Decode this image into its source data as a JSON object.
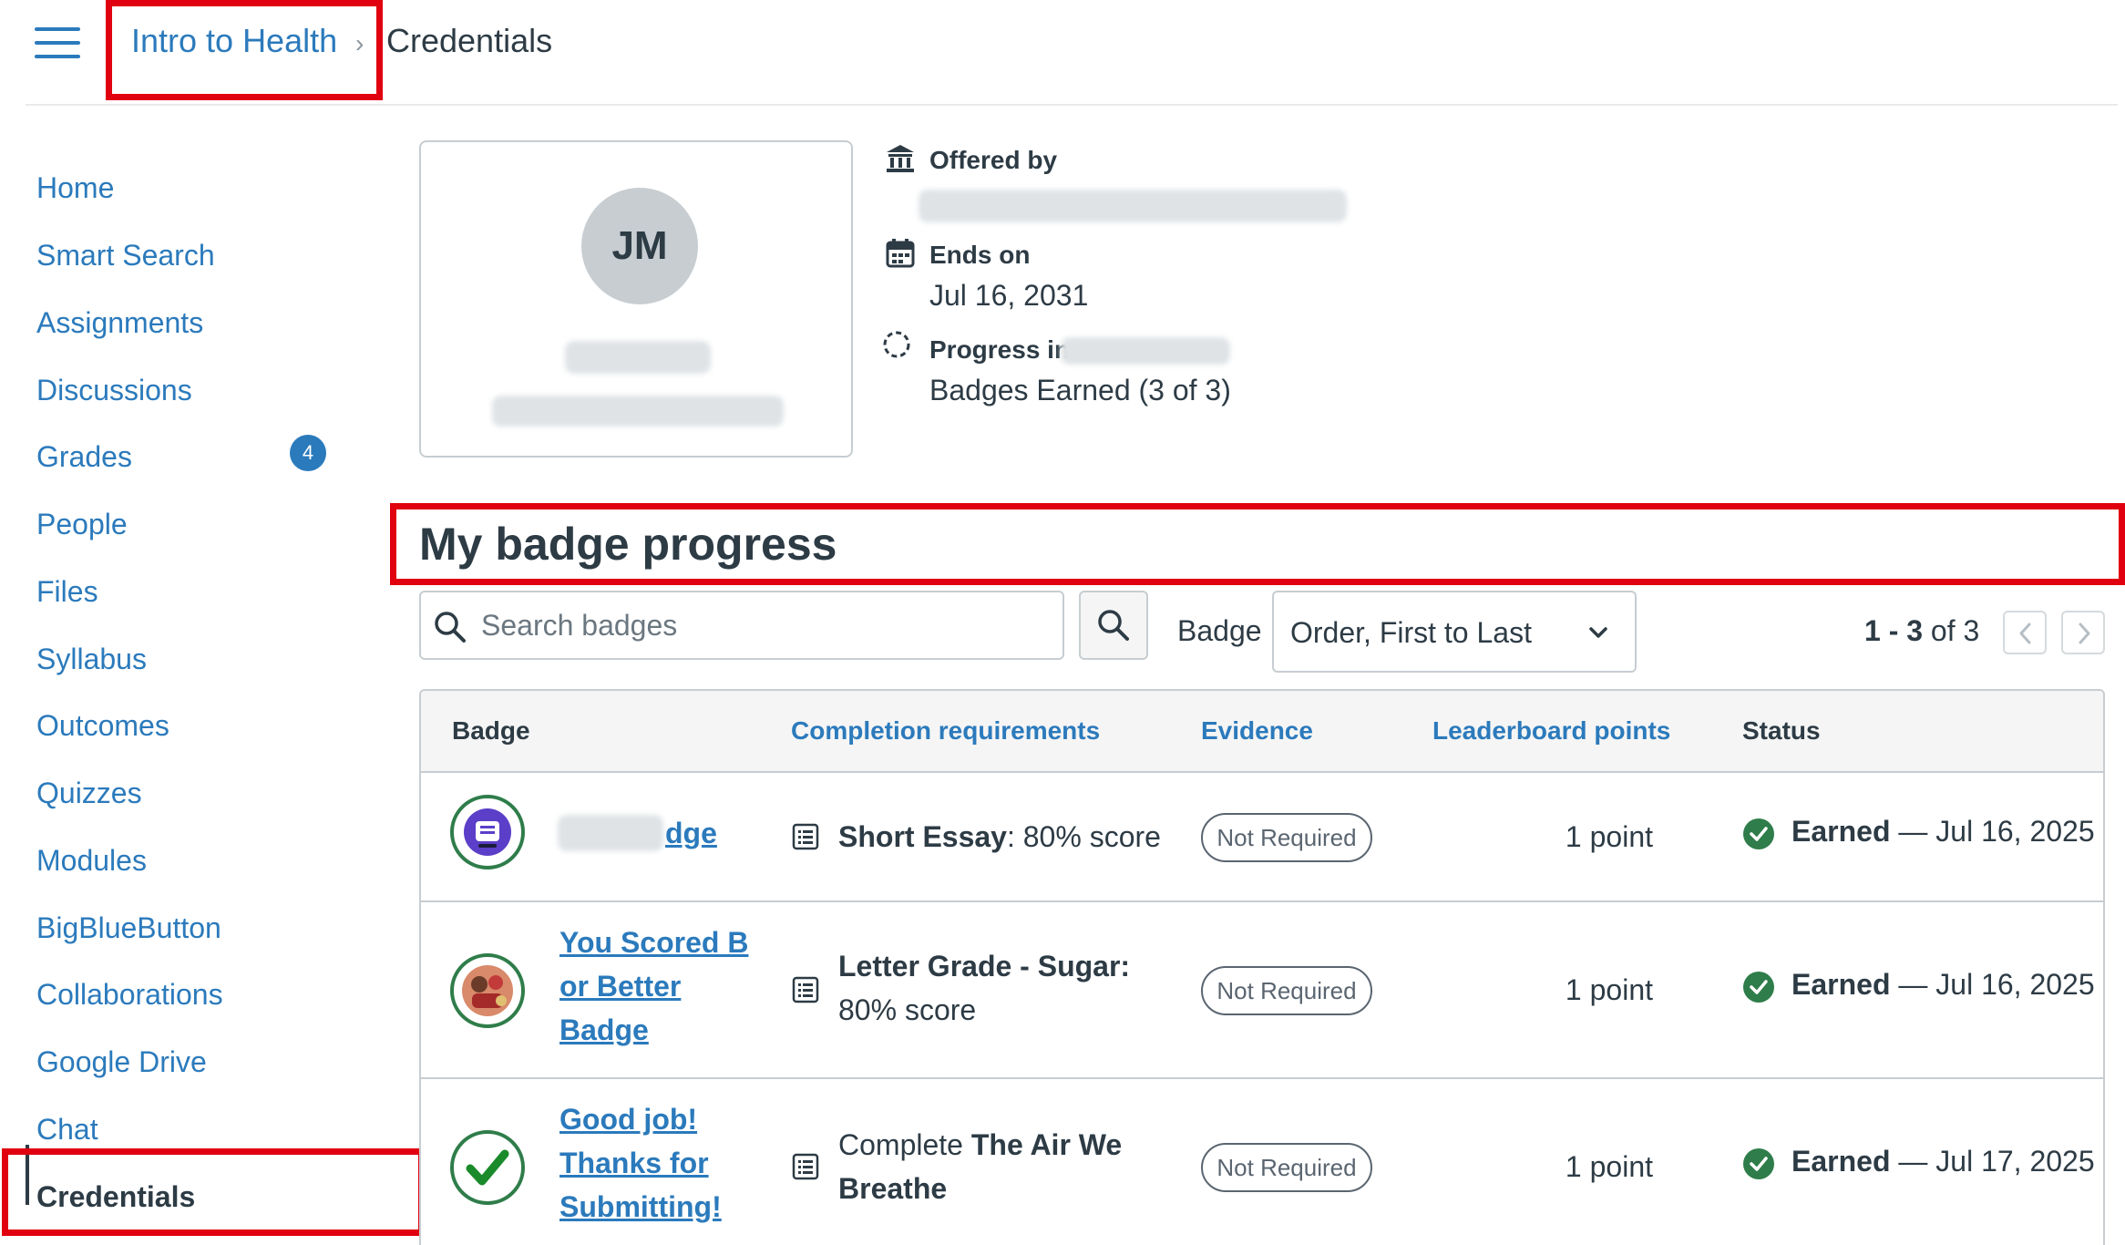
{
  "header": {
    "course": "Intro to Health",
    "separator": "›",
    "current_page": "Credentials"
  },
  "sidebar": {
    "items": [
      {
        "label": "Home"
      },
      {
        "label": "Smart Search"
      },
      {
        "label": "Assignments"
      },
      {
        "label": "Discussions"
      },
      {
        "label": "Grades",
        "badge": "4"
      },
      {
        "label": "People"
      },
      {
        "label": "Files"
      },
      {
        "label": "Syllabus"
      },
      {
        "label": "Outcomes"
      },
      {
        "label": "Quizzes"
      },
      {
        "label": "Modules"
      },
      {
        "label": "BigBlueButton"
      },
      {
        "label": "Collaborations"
      },
      {
        "label": "Google Drive"
      },
      {
        "label": "Chat"
      },
      {
        "label": "Credentials",
        "active": true
      }
    ]
  },
  "profile": {
    "initials": "JM"
  },
  "info": {
    "offered_by_label": "Offered by",
    "ends_on_label": "Ends on",
    "ends_on_value": "Jul 16, 2031",
    "progress_label": "Progress in",
    "progress_value": "Badges Earned (3 of 3)"
  },
  "section": {
    "title": "My badge progress"
  },
  "toolbar": {
    "search_placeholder": "Search badges",
    "sort_label": "Badge",
    "sort_value": "Order, First to Last",
    "page_range": "1 - 3",
    "page_of": "of 3"
  },
  "table": {
    "headers": {
      "badge": "Badge",
      "completion": "Completion requirements",
      "evidence": "Evidence",
      "points": "Leaderboard points",
      "status": "Status"
    },
    "rows": [
      {
        "badge_name": "dge",
        "req_bold": "Short Essay",
        "req_rest": ": 80% score",
        "evidence": "Not Required",
        "points": "1 point",
        "status_word": "Earned",
        "status_date": " — Jul 16, 2025"
      },
      {
        "badge_name_line1": "You Scored B",
        "badge_name_line2": "or Better",
        "badge_name_line3": "Badge",
        "req_bold": "Letter Grade - Sugar:",
        "req_rest": "80% score",
        "evidence": "Not Required",
        "points": "1 point",
        "status_word": "Earned",
        "status_date": " — Jul 16, 2025"
      },
      {
        "badge_name_line1": "Good job!",
        "badge_name_line2": "Thanks for",
        "badge_name_line3": "Submitting!",
        "req_plain": "Complete ",
        "req_bold_1": "The Air We",
        "req_bold_2": "Breathe",
        "evidence": "Not Required",
        "points": "1 point",
        "status_word": "Earned",
        "status_date": " — Jul 17, 2025"
      }
    ]
  },
  "colors": {
    "link": "#2b7abc",
    "text": "#2d3b45",
    "highlight": "#e0000f",
    "earned_green": "#2f7d4a",
    "badge_blue": "#2b7abc"
  },
  "icons": {
    "menu": "hamburger-icon",
    "breadcrumb_sep": "chevron-right-icon",
    "offered_by": "institution-icon",
    "ends_on": "calendar-icon",
    "progress": "progress-circle-icon",
    "search": "search-icon",
    "dropdown": "chevron-down-icon",
    "prev": "chevron-left-icon",
    "next": "chevron-right-icon",
    "requirement": "list-document-icon",
    "earned": "check-circle-icon"
  }
}
